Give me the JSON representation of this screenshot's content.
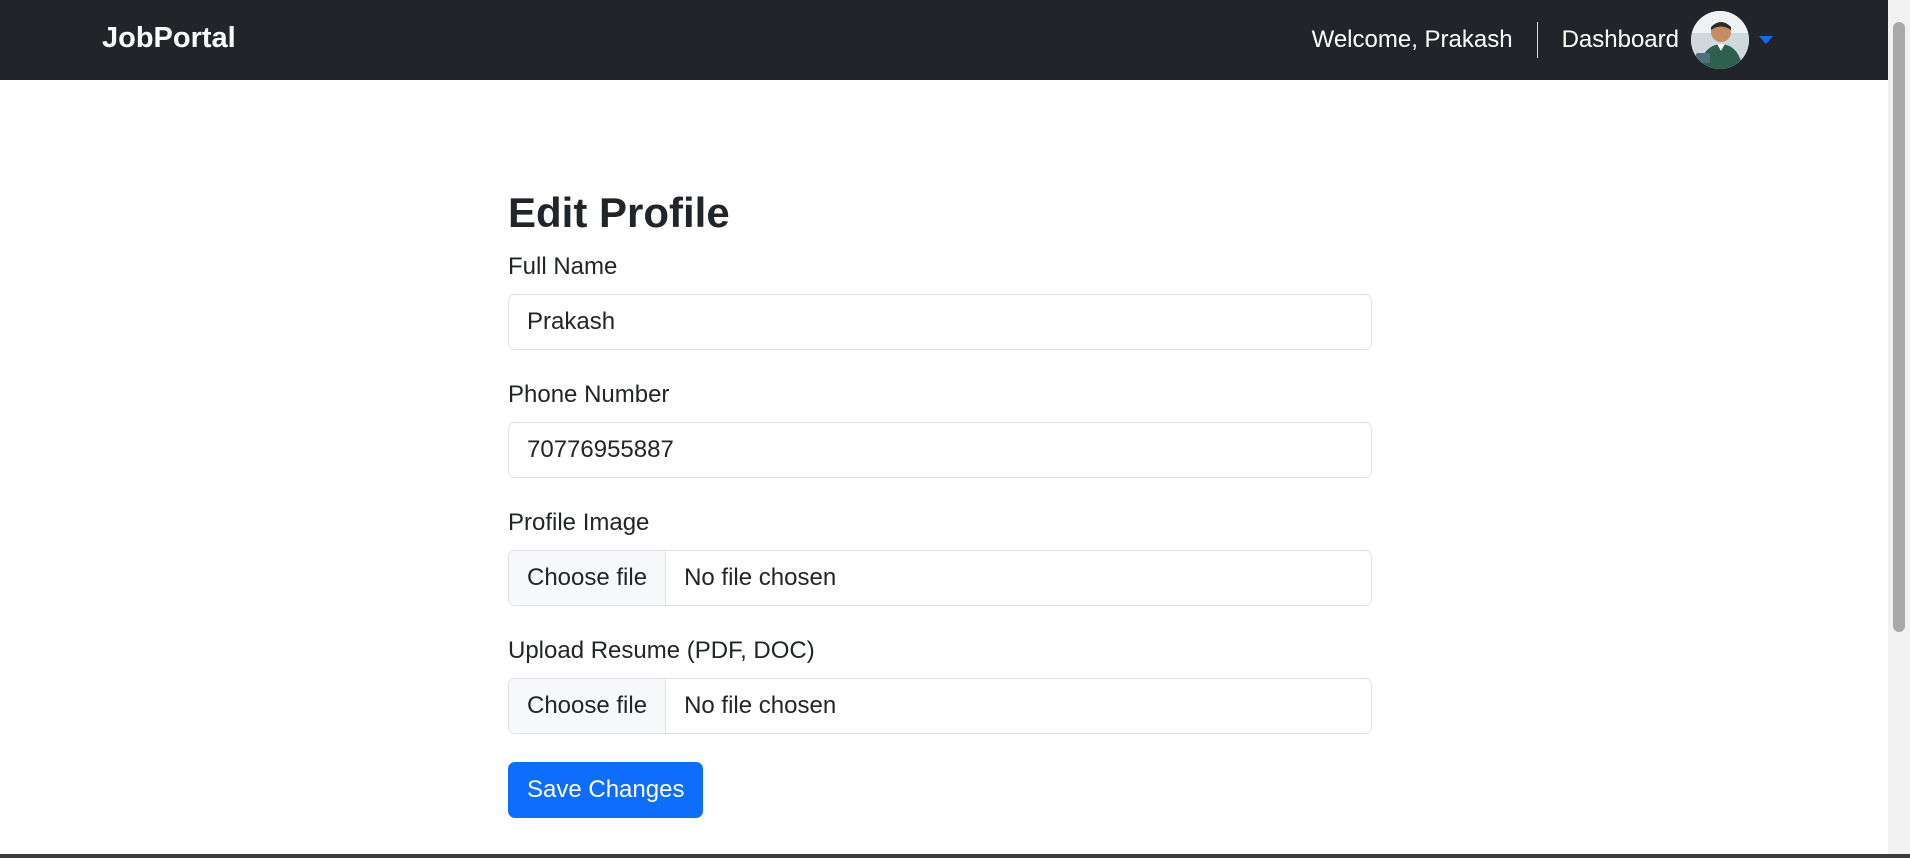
{
  "navbar": {
    "brand": "JobPortal",
    "welcome": "Welcome, Prakash",
    "dashboard": "Dashboard",
    "avatar_icon": "user-avatar",
    "caret_icon": "caret-down-icon",
    "bg_color": "#212529",
    "accent_color": "#0d6efd"
  },
  "form": {
    "title": "Edit Profile",
    "full_name": {
      "label": "Full Name",
      "value": "Prakash"
    },
    "phone": {
      "label": "Phone Number",
      "value": "70776955887"
    },
    "profile_image": {
      "label": "Profile Image",
      "button": "Choose file",
      "status": "No file chosen"
    },
    "resume": {
      "label": "Upload Resume (PDF, DOC)",
      "button": "Choose file",
      "status": "No file chosen"
    },
    "save_label": "Save Changes"
  }
}
